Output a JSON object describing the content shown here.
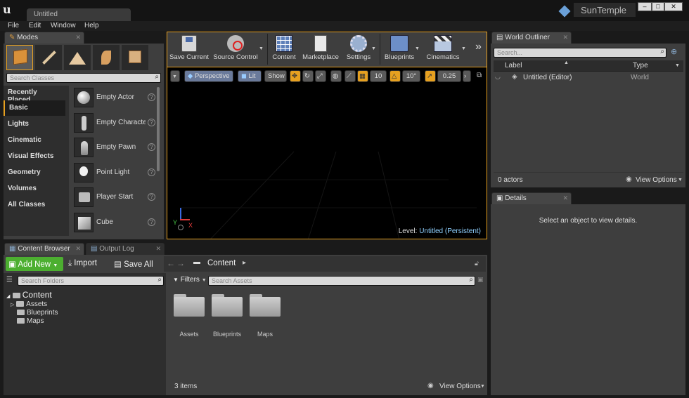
{
  "window": {
    "tab_title": "Untitled",
    "project_name": "SunTemple"
  },
  "menu": [
    "File",
    "Edit",
    "Window",
    "Help"
  ],
  "modes": {
    "tab_label": "Modes",
    "search_placeholder": "Search Classes",
    "categories": [
      "Recently Placed",
      "Basic",
      "Lights",
      "Cinematic",
      "Visual Effects",
      "Geometry",
      "Volumes",
      "All Classes"
    ],
    "active_category": "Basic",
    "actors": [
      "Empty Actor",
      "Empty Character",
      "Empty Pawn",
      "Point Light",
      "Player Start",
      "Cube"
    ]
  },
  "toolbar": {
    "buttons": [
      {
        "label": "Save Current",
        "icon": "floppy-icon"
      },
      {
        "label": "Source Control",
        "icon": "source-control-icon"
      },
      {
        "label": "Content",
        "icon": "content-grid-icon"
      },
      {
        "label": "Marketplace",
        "icon": "marketplace-bag-icon"
      },
      {
        "label": "Settings",
        "icon": "settings-gears-icon"
      },
      {
        "label": "Blueprints",
        "icon": "blueprints-icon"
      },
      {
        "label": "Cinematics",
        "icon": "clapper-icon"
      }
    ]
  },
  "viewport": {
    "perspective_label": "Perspective",
    "lit_label": "Lit",
    "show_label": "Show",
    "grid_snap": "10",
    "rotation_snap": "10°",
    "scale_snap": "0.25",
    "level_prefix": "Level:",
    "level_name": "Untitled (Persistent)",
    "axis_x": "X",
    "axis_y": "Y"
  },
  "outliner": {
    "tab_label": "World Outliner",
    "search_placeholder": "Search...",
    "col_label": "Label",
    "col_type": "Type",
    "row_label": "Untitled (Editor)",
    "row_type": "World",
    "actor_count": "0 actors",
    "view_options": "View Options"
  },
  "details": {
    "tab_label": "Details",
    "empty_message": "Select an object to view details."
  },
  "content_browser": {
    "tab_label": "Content Browser",
    "output_tab_label": "Output Log",
    "add_new": "Add New",
    "import": "Import",
    "save_all": "Save All",
    "path_root": "Content",
    "search_folders_placeholder": "Search Folders",
    "filters_label": "Filters",
    "search_assets_placeholder": "Search Assets",
    "tree_root": "Content",
    "tree_children": [
      "Assets",
      "Blueprints",
      "Maps"
    ],
    "folders": [
      "Assets",
      "Blueprints",
      "Maps"
    ],
    "item_count": "3 items",
    "view_options": "View Options"
  },
  "colors": {
    "accent": "#e6a020",
    "add_new_green": "#4caf30",
    "level_link": "#8fd0ff"
  }
}
